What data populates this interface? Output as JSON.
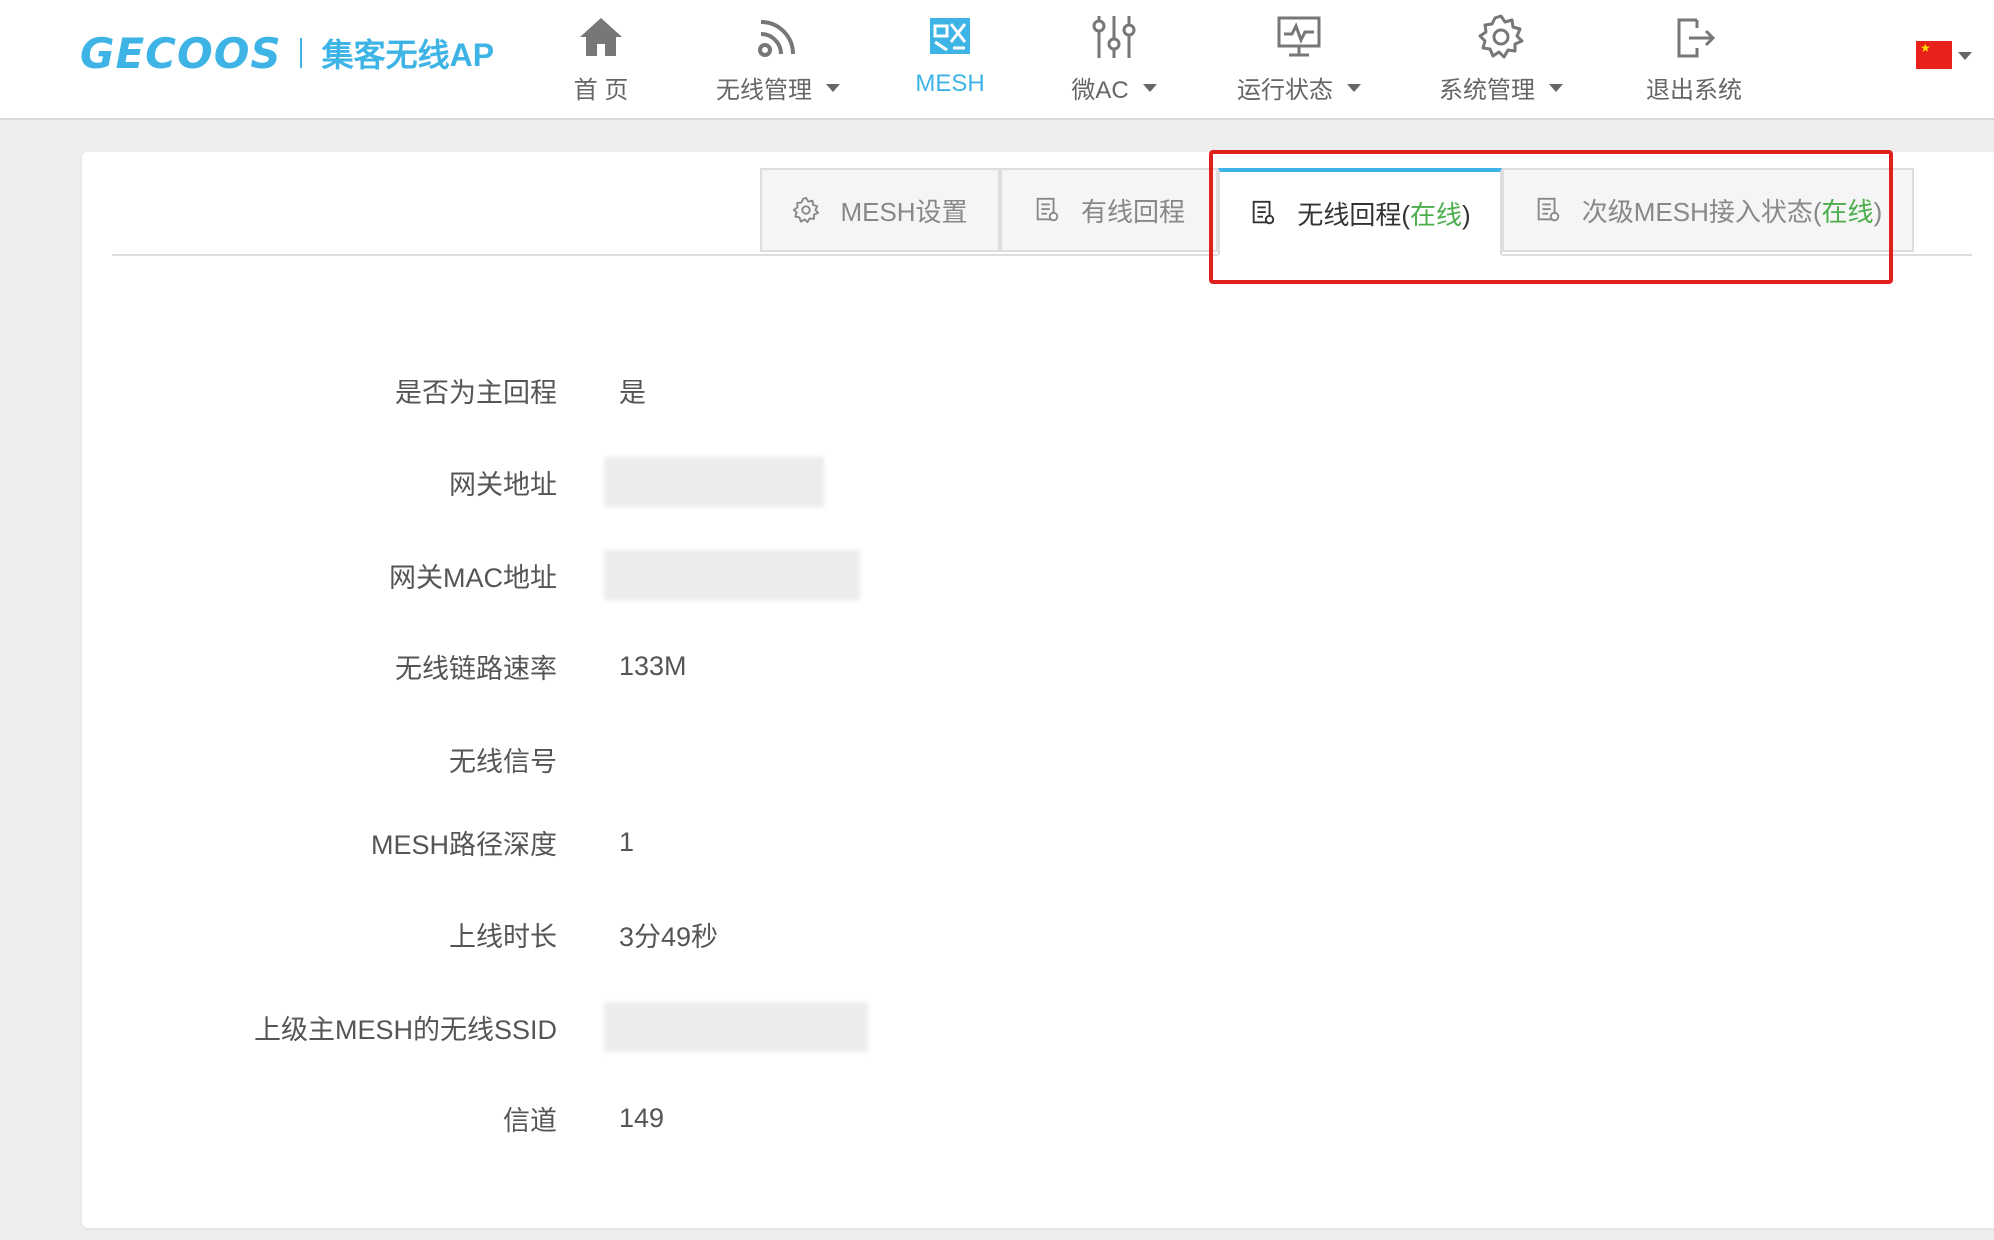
{
  "header": {
    "brand": "GECOOS",
    "subtitle": "集客无线AP",
    "nav": [
      {
        "label": "首 页",
        "icon": "home-icon"
      },
      {
        "label": "无线管理",
        "icon": "wifi-icon",
        "dropdown": true
      },
      {
        "label": "MESH",
        "icon": "mesh-icon",
        "active": true
      },
      {
        "label": "微AC",
        "icon": "sliders-icon",
        "dropdown": true
      },
      {
        "label": "运行状态",
        "icon": "monitor-icon",
        "dropdown": true
      },
      {
        "label": "系统管理",
        "icon": "gear-icon",
        "dropdown": true
      },
      {
        "label": "退出系统",
        "icon": "logout-icon"
      }
    ],
    "language": "cn-flag-icon"
  },
  "tabs": {
    "mesh_settings": "MESH设置",
    "wired_backhaul": "有线回程",
    "wireless_backhaul": "无线回程",
    "wireless_backhaul_status": "在线",
    "sub_mesh_access": "次级MESH接入状态",
    "sub_mesh_access_status": "在线",
    "open_paren": "(",
    "close_paren": ")"
  },
  "info": {
    "rows": [
      {
        "label": "是否为主回程",
        "value": "是"
      },
      {
        "label": "网关地址",
        "value": ""
      },
      {
        "label": "网关MAC地址",
        "value": ""
      },
      {
        "label": "无线链路速率",
        "value": "133M"
      },
      {
        "label": "无线信号",
        "value": ""
      },
      {
        "label": "MESH路径深度",
        "value": "1"
      },
      {
        "label": "上线时长",
        "value": "3分49秒"
      },
      {
        "label": "上级主MESH的无线SSID",
        "value": ""
      },
      {
        "label": "信道",
        "value": "149"
      }
    ]
  },
  "colors": {
    "accent": "#3db4e5",
    "online": "#4cae4c",
    "highlight": "#e0201f"
  }
}
